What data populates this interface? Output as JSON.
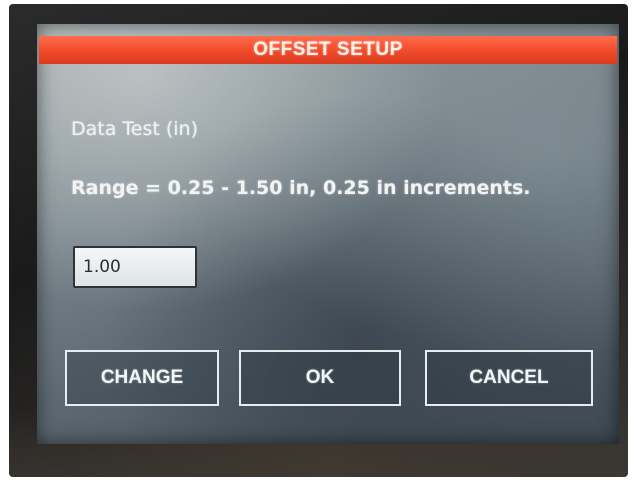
{
  "dialog": {
    "title": "OFFSET SETUP",
    "data_label": "Data Test (in)",
    "range_text": "Range = 0.25 - 1.50 in, 0.25 in increments.",
    "value": "1.00"
  },
  "buttons": {
    "change_label": "CHANGE",
    "ok_label": "OK",
    "cancel_label": "CANCEL"
  },
  "colors": {
    "title_bar": "#f04a2a",
    "screen_background": "#6f7b82",
    "text": "#f2f4f4"
  }
}
